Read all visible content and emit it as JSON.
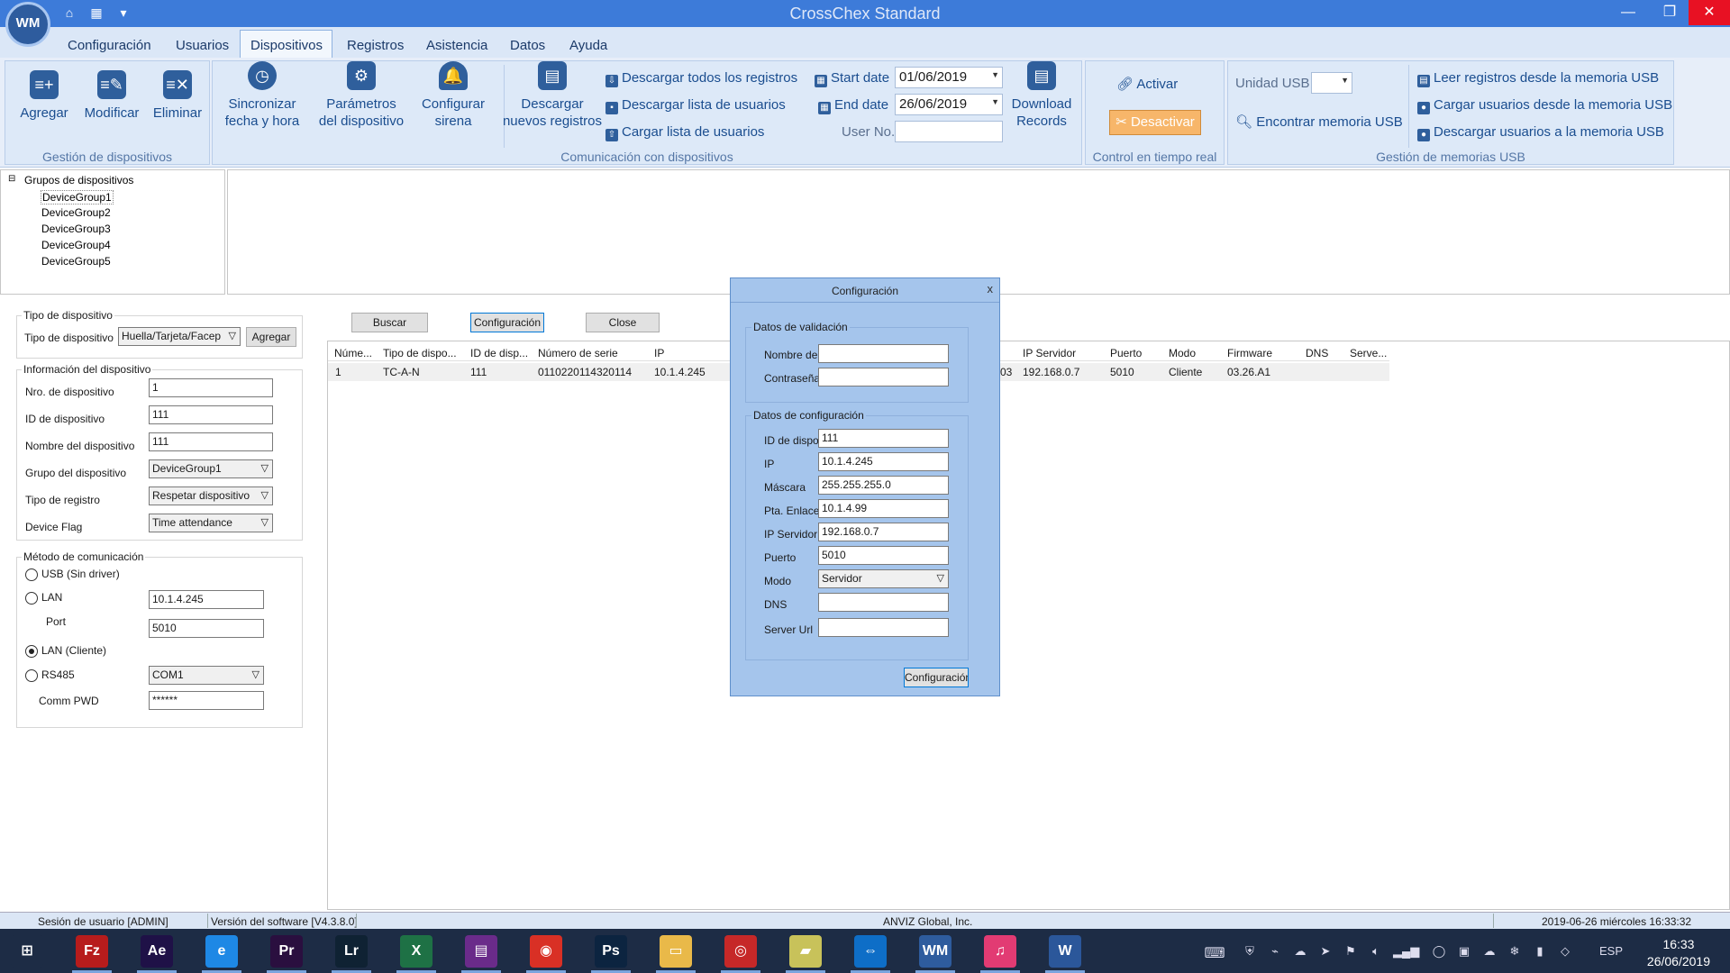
{
  "window": {
    "title": "CrossChex Standard",
    "logo_text": "WM",
    "controls": [
      "—",
      "❐",
      "✕"
    ]
  },
  "menu": [
    "Configuración",
    "Usuarios",
    "Dispositivos",
    "Registros",
    "Asistencia",
    "Datos",
    "Ayuda"
  ],
  "menu_active": "Dispositivos",
  "ribbon": {
    "device_mgmt": {
      "label": "Gestión de dispositivos",
      "add": "Agregar",
      "modify": "Modificar",
      "delete": "Eliminar"
    },
    "comm": {
      "label": "Comunicación con dispositivos",
      "sync_1": "Sincronizar",
      "sync_2": "fecha y hora",
      "params_1": "Parámetros",
      "params_2": "del dispositivo",
      "siren_1": "Configurar",
      "siren_2": "sirena",
      "download_new_1": "Descargar",
      "download_new_2": "nuevos registros",
      "download_all": "Descargar todos los registros",
      "download_users": "Descargar lista de usuarios",
      "upload_users": "Cargar lista de usuarios",
      "start_label": "Start date",
      "start_value": "01/06/2019",
      "end_label": "End date",
      "end_value": "26/06/2019",
      "user_no_label": "User No.",
      "user_no_value": "",
      "download_records_1": "Download",
      "download_records_2": "Records"
    },
    "realtime": {
      "label": "Control en tiempo real",
      "activate": "Activar",
      "deactivate": "Desactivar"
    },
    "usb": {
      "label": "Gestión de memorias USB",
      "unit_label": "Unidad USB",
      "unit_value": "",
      "find": "Encontrar memoria USB",
      "read": "Leer registros desde la memoria USB",
      "load_users": "Cargar usuarios desde la memoria USB",
      "download_users": "Descargar usuarios a la memoria USB"
    }
  },
  "tree": {
    "root": "Grupos de dispositivos",
    "items": [
      "DeviceGroup1",
      "DeviceGroup2",
      "DeviceGroup3",
      "DeviceGroup4",
      "DeviceGroup5"
    ]
  },
  "left_panel": {
    "device_type_group": "Tipo de dispositivo",
    "device_type_label": "Tipo de dispositivo",
    "device_type_value": "Huella/Tarjeta/Facep",
    "add_button": "Agregar",
    "info_group": "Información del dispositivo",
    "fields": [
      {
        "label": "Nro. de dispositivo",
        "value": "1"
      },
      {
        "label": "ID de dispositivo",
        "value": "111"
      },
      {
        "label": "Nombre del dispositivo",
        "value": "111"
      }
    ],
    "selects": [
      {
        "label": "Grupo del dispositivo",
        "value": "DeviceGroup1"
      },
      {
        "label": "Tipo de registro",
        "value": "Respetar dispositivo"
      },
      {
        "label": "Device Flag",
        "value": "Time attendance"
      }
    ],
    "comm_group": "Método de comunicación",
    "usb_label": "USB (Sin driver)",
    "lan_label": "LAN",
    "lan_ip": "10.1.4.245",
    "port_label": "Port",
    "port_value": "5010",
    "lan_client_label": "LAN (Cliente)",
    "rs485_label": "RS485",
    "com_value": "COM1",
    "comm_pwd_label": "Comm PWD",
    "comm_pwd_value": "******"
  },
  "toolbar": {
    "search": "Buscar",
    "config": "Configuración",
    "close": "Close"
  },
  "grid": {
    "headers": [
      "Núme...",
      "Tipo de dispo...",
      "ID de disp...",
      "Número de serie",
      "IP",
      "IP Servidor",
      "Puerto",
      "Modo",
      "Firmware",
      "DNS",
      "Serve..."
    ],
    "row": {
      "num": "1",
      "type": "TC-A-N",
      "id": "111",
      "serial": "0110220114320114",
      "ip": "10.1.4.245",
      "partial": "03",
      "server_ip": "192.168.0.7",
      "port": "5010",
      "mode": "Cliente",
      "firmware": "03.26.A1"
    }
  },
  "dialog": {
    "title": "Configuración",
    "close": "x",
    "validation_group": "Datos de validación",
    "user_label": "Nombre de",
    "user_value": "",
    "pwd_label": "Contraseña",
    "pwd_value": "",
    "config_group": "Datos de configuración",
    "fields": [
      {
        "label": "ID de dispo",
        "value": "111"
      },
      {
        "label": "IP",
        "value": "10.1.4.245"
      },
      {
        "label": "Máscara",
        "value": "255.255.255.0"
      },
      {
        "label": "Pta. Enlace",
        "value": "10.1.4.99"
      },
      {
        "label": "IP Servidor",
        "value": "192.168.0.7"
      },
      {
        "label": "Puerto",
        "value": "5010"
      }
    ],
    "mode_label": "Modo",
    "mode_value": "Servidor",
    "dns_label": "DNS",
    "dns_value": "",
    "url_label": "Server Url",
    "url_value": "",
    "ok_button": "Configuración"
  },
  "statusbar": {
    "session": "Sesión de usuario  [ADMIN]",
    "version": "Versión del software  [V4.3.8.0]",
    "company": "ANVIZ Global, Inc.",
    "datetime": "2019-06-26 miércoles 16:33:32"
  },
  "taskbar": {
    "apps": [
      {
        "name": "windows-start",
        "label": "⊞",
        "color": "#1d2c45"
      },
      {
        "name": "filezilla",
        "label": "Fz",
        "color": "#b71c1c"
      },
      {
        "name": "after-effects",
        "label": "Ae",
        "color": "#1f1147"
      },
      {
        "name": "internet-explorer",
        "label": "e",
        "color": "#1e88e5"
      },
      {
        "name": "premiere",
        "label": "Pr",
        "color": "#2a0f3f"
      },
      {
        "name": "lightroom",
        "label": "Lr",
        "color": "#0f2233"
      },
      {
        "name": "excel",
        "label": "X",
        "color": "#1e7145"
      },
      {
        "name": "winrar",
        "label": "▤",
        "color": "#6a2b8a"
      },
      {
        "name": "chrome",
        "label": "◉",
        "color": "#d93025"
      },
      {
        "name": "photoshop",
        "label": "Ps",
        "color": "#0c2440"
      },
      {
        "name": "file-explorer",
        "label": "▭",
        "color": "#e9b949"
      },
      {
        "name": "media-app",
        "label": "◎",
        "color": "#c62828"
      },
      {
        "name": "sticky-notes",
        "label": "▰",
        "color": "#c8c25a"
      },
      {
        "name": "teamviewer",
        "label": "⇔",
        "color": "#0e6ec7"
      },
      {
        "name": "crosschex",
        "label": "WM",
        "color": "#2e5c9e"
      },
      {
        "name": "itunes",
        "label": "♫",
        "color": "#e23b73"
      },
      {
        "name": "word",
        "label": "W",
        "color": "#2b579a"
      }
    ],
    "lang": "ESP",
    "time": "16:33",
    "date": "26/06/2019"
  }
}
